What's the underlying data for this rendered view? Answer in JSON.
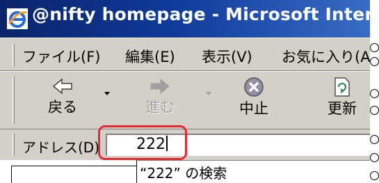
{
  "window": {
    "title": "@nifty homepage - Microsoft Internet Ex"
  },
  "menu": {
    "items": [
      "ファイル(F)",
      "編集(E)",
      "表示(V)",
      "お気に入り(A)"
    ]
  },
  "toolbar": {
    "back_label": "戻る",
    "forward_label": "進む",
    "stop_label": "中止",
    "refresh_label": "更新"
  },
  "address": {
    "label": "アドレス(D)",
    "value": "222"
  },
  "autocomplete": {
    "suggestion": "“222” の検索"
  },
  "colors": {
    "highlight": "#e8282e",
    "titlebar": "#0a246a"
  },
  "icons": {
    "title": "ie-logo-icon",
    "back": "back-arrow-icon",
    "forward": "forward-arrow-icon",
    "stop": "stop-icon",
    "refresh": "refresh-icon"
  }
}
